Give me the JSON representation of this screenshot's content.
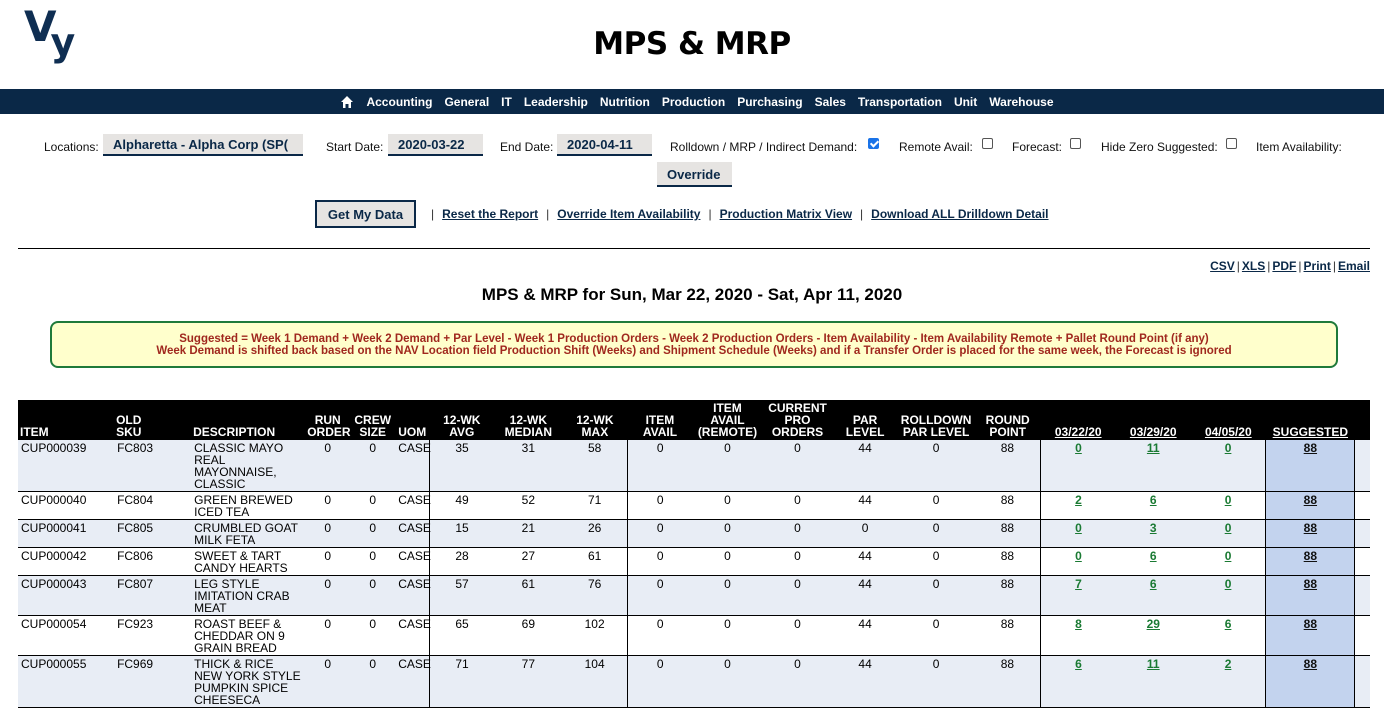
{
  "header": {
    "logo_v": "V",
    "logo_y": "y",
    "title": "MPS & MRP"
  },
  "nav": {
    "home_icon": "home-icon",
    "items": [
      "Accounting",
      "General",
      "IT",
      "Leadership",
      "Nutrition",
      "Production",
      "Purchasing",
      "Sales",
      "Transportation",
      "Unit",
      "Warehouse"
    ]
  },
  "filters": {
    "locations_label": "Locations:",
    "locations_value": "Alpharetta - Alpha Corp (SP(",
    "start_label": "Start Date:",
    "start_value": "2020-03-22",
    "end_label": "End Date:",
    "end_value": "2020-04-11",
    "rolldown_label": "Rolldown / MRP / Indirect Demand:",
    "rolldown_checked": true,
    "remote_label": "Remote Avail:",
    "remote_checked": false,
    "forecast_label": "Forecast:",
    "forecast_checked": false,
    "hidezero_label": "Hide Zero Suggested:",
    "hidezero_checked": false,
    "itemavail_label": "Item Availability:",
    "itemavail_value": "Override"
  },
  "actions": {
    "get_data": "Get My Data",
    "links": [
      "Reset the Report",
      "Override Item Availability",
      "Production Matrix View",
      "Download ALL Drilldown Detail"
    ],
    "separator": "|"
  },
  "exports": [
    "CSV",
    "XLS",
    "PDF",
    "Print",
    "Email"
  ],
  "report": {
    "title": "MPS & MRP for Sun, Mar 22, 2020 - Sat, Apr 11, 2020",
    "notice_line1": "Suggested = Week 1 Demand + Week 2 Demand + Par Level - Week 1 Production Orders - Week 2 Production Orders - Item Availability - Item Availability Remote + Pallet Round Point (if any)",
    "notice_line2": "Week Demand is shifted back based on the NAV Location field Production Shift (Weeks) and Shipment Schedule (Weeks) and if a Transfer Order is placed for the same week, the Forecast is ignored"
  },
  "table": {
    "headers": {
      "item": "ITEM",
      "old_sku_1": "OLD",
      "old_sku_2": "SKU",
      "description": "DESCRIPTION",
      "run_order_1": "RUN",
      "run_order_2": "ORDER",
      "crew_size_1": "CREW",
      "crew_size_2": "SIZE",
      "uom": "UOM",
      "avg_1": "12-WK",
      "avg_2": "AVG",
      "median_1": "12-WK",
      "median_2": "MEDIAN",
      "max_1": "12-WK",
      "max_2": "MAX",
      "item_avail_1": "ITEM",
      "item_avail_2": "AVAIL",
      "remote_1": "ITEM",
      "remote_2": "AVAIL",
      "remote_3": "(REMOTE)",
      "pro_1": "CURRENT",
      "pro_2": "PRO",
      "pro_3": "ORDERS",
      "par_1": "PAR",
      "par_2": "LEVEL",
      "rpar_1": "ROLLDOWN",
      "rpar_2": "PAR LEVEL",
      "round_1": "ROUND",
      "round_2": "POINT",
      "wk1": "03/22/20",
      "wk2": "03/29/20",
      "wk3": "04/05/20",
      "suggested": "SUGGESTED"
    },
    "rows": [
      {
        "item": "CUP000039",
        "old_sku": "FC803",
        "description": "CLASSIC MAYO REAL MAYONNAISE, CLASSIC",
        "run_order": "0",
        "crew_size": "0",
        "uom": "CASE",
        "avg": "35",
        "median": "31",
        "max": "58",
        "item_avail": "0",
        "remote": "0",
        "pro": "0",
        "par": "44",
        "rpar": "0",
        "round": "88",
        "wk1": "0",
        "wk2": "11",
        "wk3": "0",
        "suggested": "88"
      },
      {
        "item": "CUP000040",
        "old_sku": "FC804",
        "description": "GREEN BREWED ICED TEA",
        "run_order": "0",
        "crew_size": "0",
        "uom": "CASE",
        "avg": "49",
        "median": "52",
        "max": "71",
        "item_avail": "0",
        "remote": "0",
        "pro": "0",
        "par": "44",
        "rpar": "0",
        "round": "88",
        "wk1": "2",
        "wk2": "6",
        "wk3": "0",
        "suggested": "88"
      },
      {
        "item": "CUP000041",
        "old_sku": "FC805",
        "description": "CRUMBLED GOAT MILK FETA",
        "run_order": "0",
        "crew_size": "0",
        "uom": "CASE",
        "avg": "15",
        "median": "21",
        "max": "26",
        "item_avail": "0",
        "remote": "0",
        "pro": "0",
        "par": "0",
        "rpar": "0",
        "round": "88",
        "wk1": "0",
        "wk2": "3",
        "wk3": "0",
        "suggested": "88"
      },
      {
        "item": "CUP000042",
        "old_sku": "FC806",
        "description": "SWEET & TART CANDY HEARTS",
        "run_order": "0",
        "crew_size": "0",
        "uom": "CASE",
        "avg": "28",
        "median": "27",
        "max": "61",
        "item_avail": "0",
        "remote": "0",
        "pro": "0",
        "par": "44",
        "rpar": "0",
        "round": "88",
        "wk1": "0",
        "wk2": "6",
        "wk3": "0",
        "suggested": "88"
      },
      {
        "item": "CUP000043",
        "old_sku": "FC807",
        "description": "LEG STYLE IMITATION CRAB MEAT",
        "run_order": "0",
        "crew_size": "0",
        "uom": "CASE",
        "avg": "57",
        "median": "61",
        "max": "76",
        "item_avail": "0",
        "remote": "0",
        "pro": "0",
        "par": "44",
        "rpar": "0",
        "round": "88",
        "wk1": "7",
        "wk2": "6",
        "wk3": "0",
        "suggested": "88"
      },
      {
        "item": "CUP000054",
        "old_sku": "FC923",
        "description": "ROAST BEEF & CHEDDAR ON 9 GRAIN BREAD",
        "run_order": "0",
        "crew_size": "0",
        "uom": "CASE",
        "avg": "65",
        "median": "69",
        "max": "102",
        "item_avail": "0",
        "remote": "0",
        "pro": "0",
        "par": "44",
        "rpar": "0",
        "round": "88",
        "wk1": "8",
        "wk2": "29",
        "wk3": "6",
        "suggested": "88"
      },
      {
        "item": "CUP000055",
        "old_sku": "FC969",
        "description": "THICK & RICE NEW YORK STYLE PUMPKIN SPICE CHEESECA",
        "run_order": "0",
        "crew_size": "0",
        "uom": "CASE",
        "avg": "71",
        "median": "77",
        "max": "104",
        "item_avail": "0",
        "remote": "0",
        "pro": "0",
        "par": "44",
        "rpar": "0",
        "round": "88",
        "wk1": "6",
        "wk2": "11",
        "wk3": "2",
        "suggested": "88"
      }
    ]
  },
  "colors": {
    "brand_navy": "#0a2847",
    "week_link_green": "#1a7a33",
    "notice_text": "#a0281e",
    "notice_border": "#1f7a3a",
    "notice_bg": "#ffffcc",
    "suggested_bg": "#c3d3ee",
    "row_alt_bg": "#e8edf5"
  }
}
